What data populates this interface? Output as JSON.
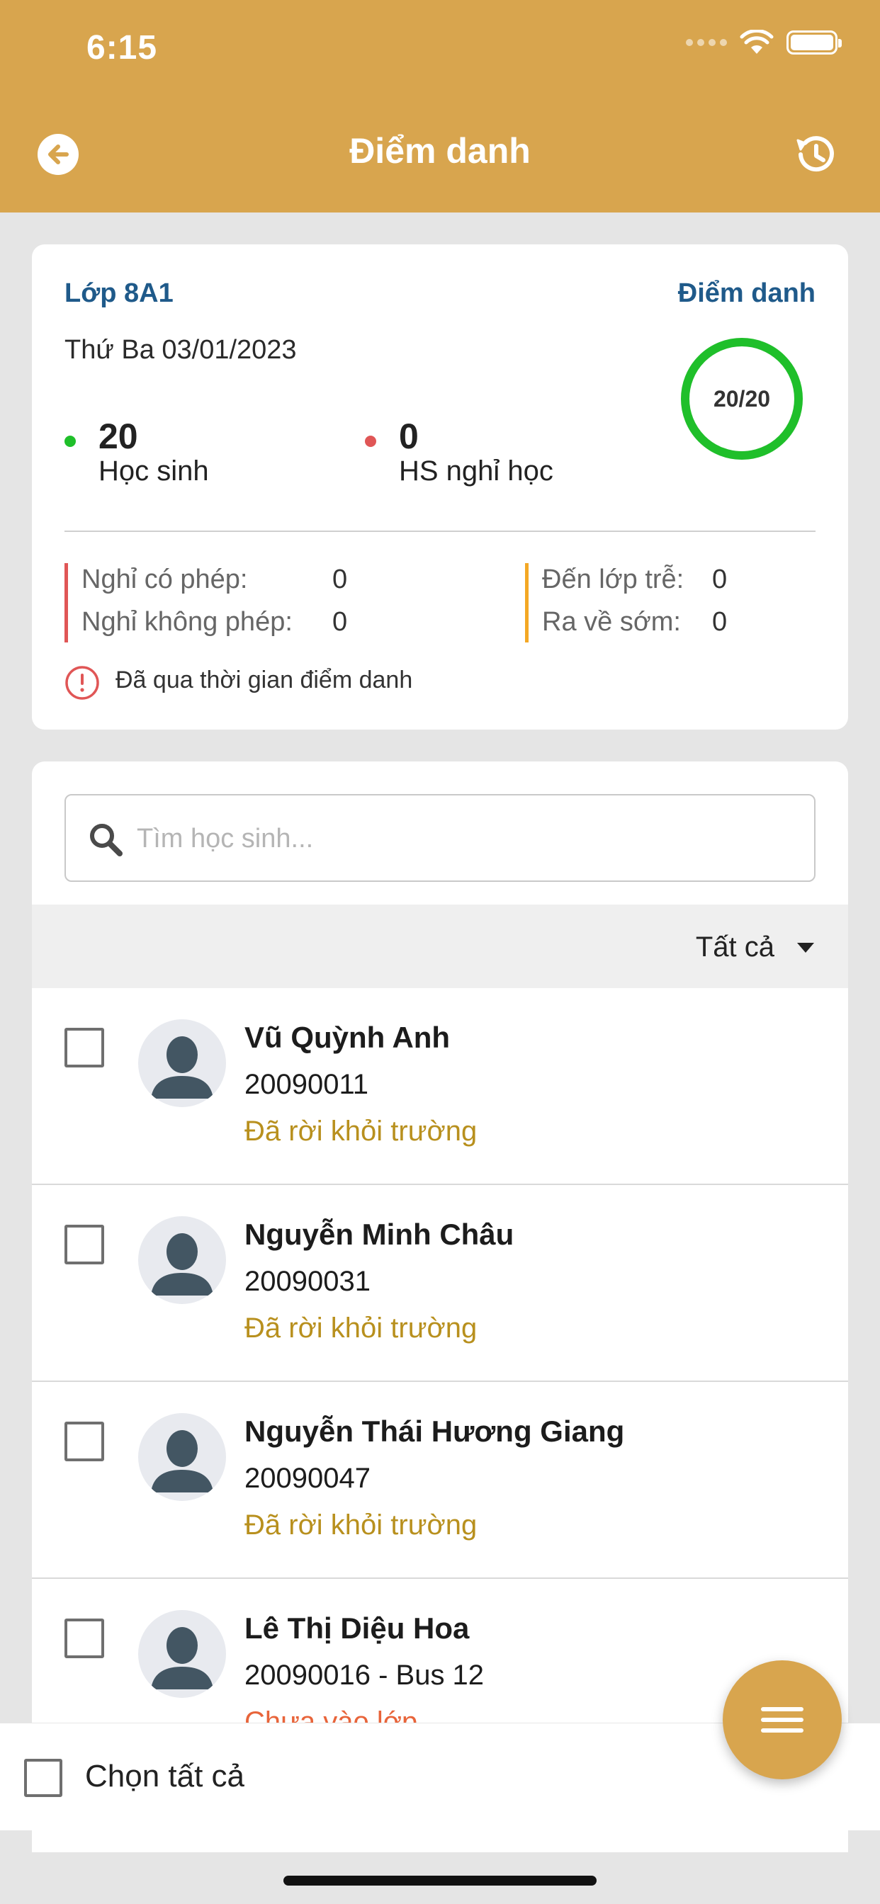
{
  "status_bar": {
    "time": "6:15"
  },
  "nav": {
    "title": "Điểm danh"
  },
  "summary": {
    "class_name": "Lớp 8A1",
    "attend_link": "Điểm danh",
    "date": "Thứ Ba 03/01/2023",
    "ring_label": "20/20",
    "ring_progress": 1.0,
    "students": {
      "count": "20",
      "label": "Học sinh",
      "dot_color": "#1fbf2a"
    },
    "absent": {
      "count": "0",
      "label": "HS nghỉ học",
      "dot_color": "#e05656"
    },
    "excused_label": "Nghỉ có phép:",
    "excused_value": "0",
    "unexcused_label": "Nghỉ không phép:",
    "unexcused_value": "0",
    "late_label": "Đến lớp trễ:",
    "late_value": "0",
    "early_label": "Ra về sớm:",
    "early_value": "0",
    "warning": "Đã qua thời gian điểm danh"
  },
  "search": {
    "placeholder": "Tìm học sinh..."
  },
  "filter": {
    "label": "Tất cả"
  },
  "students": [
    {
      "name": "Vũ Quỳnh Anh",
      "code": "20090011",
      "status": "Đã rời khỏi trường",
      "status_color": "#b8901e"
    },
    {
      "name": "Nguyễn Minh Châu",
      "code": "20090031",
      "status": "Đã rời khỏi trường",
      "status_color": "#b8901e"
    },
    {
      "name": "Nguyễn Thái Hương Giang",
      "code": "20090047",
      "status": "Đã rời khỏi trường",
      "status_color": "#b8901e"
    },
    {
      "name": "Lê Thị Diệu Hoa",
      "code": "20090016 - Bus 12",
      "status": "Chưa vào lớp",
      "status_color": "#e8643a"
    }
  ],
  "bottom": {
    "select_all_label": "Chọn tất cả"
  },
  "colors": {
    "brand": "#d8a54e",
    "link": "#1f5a8a",
    "ring": "#1fbf2a"
  }
}
